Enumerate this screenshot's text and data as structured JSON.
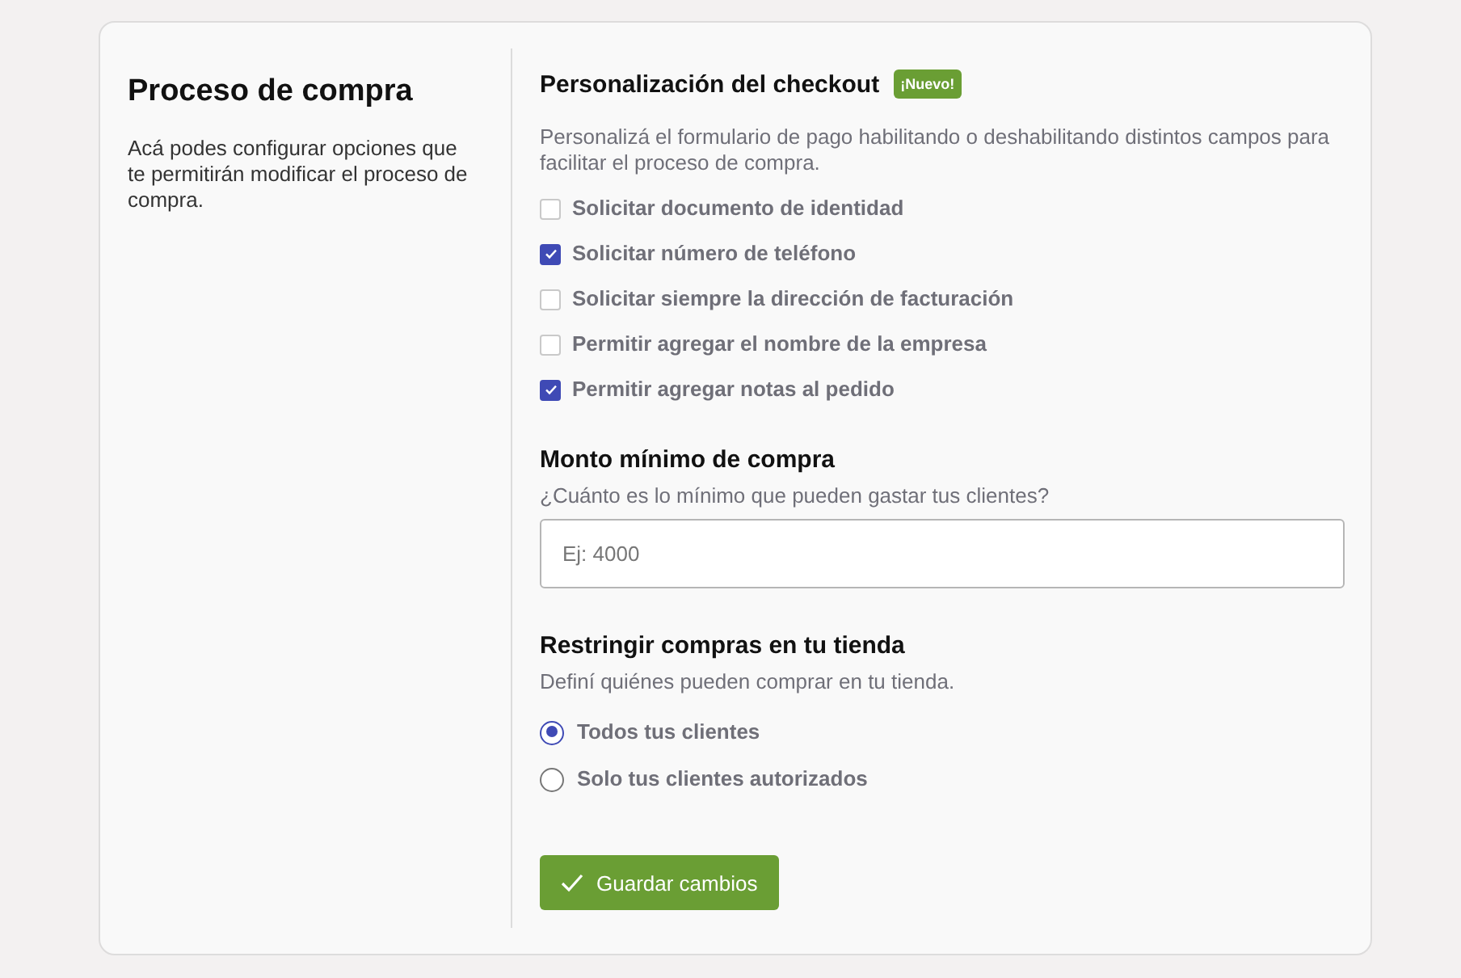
{
  "intro": {
    "title": "Proceso de compra",
    "description": "Acá podes configurar opciones que te permitirán modificar el proceso de compra."
  },
  "checkout": {
    "title": "Personalización del checkout",
    "badge": "¡Nuevo!",
    "description": "Personalizá el formulario de pago habilitando o deshabilitando distintos campos para facilitar el proceso de compra.",
    "options": [
      {
        "label": "Solicitar documento de identidad",
        "checked": false
      },
      {
        "label": "Solicitar número de teléfono",
        "checked": true
      },
      {
        "label": "Solicitar siempre la dirección de facturación",
        "checked": false
      },
      {
        "label": "Permitir agregar el nombre de la empresa",
        "checked": false
      },
      {
        "label": "Permitir agregar notas al pedido",
        "checked": true
      }
    ]
  },
  "minimum": {
    "title": "Monto mínimo de compra",
    "description": "¿Cuánto es lo mínimo que pueden gastar tus clientes?",
    "placeholder": "Ej: 4000"
  },
  "restrict": {
    "title": "Restringir compras en tu tienda",
    "description": "Definí quiénes pueden comprar en tu tienda.",
    "options": [
      {
        "label": "Todos tus clientes",
        "selected": true
      },
      {
        "label": "Solo tus clientes autorizados",
        "selected": false
      }
    ]
  },
  "save_button": "Guardar cambios"
}
